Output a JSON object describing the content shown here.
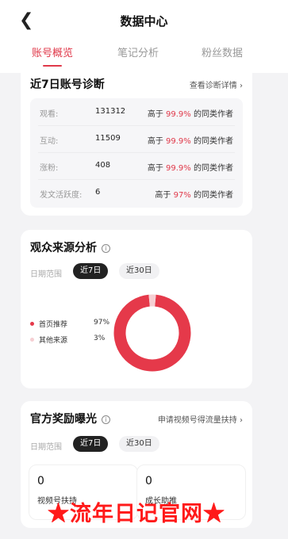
{
  "header": {
    "back_icon": "chevron-left-icon",
    "title": "数据中心",
    "tabs": [
      {
        "label": "账号概览",
        "active": true
      },
      {
        "label": "笔记分析",
        "active": false
      },
      {
        "label": "粉丝数据",
        "active": false
      }
    ]
  },
  "diagnosis": {
    "title": "近7日账号诊断",
    "link": "查看诊断详情 ›",
    "rows": [
      {
        "label": "观看:",
        "value": "131312",
        "prefix": "高于",
        "percent": "99.9%",
        "suffix": "的同类作者"
      },
      {
        "label": "互动:",
        "value": "11509",
        "prefix": "高于",
        "percent": "99.9%",
        "suffix": "的同类作者"
      },
      {
        "label": "涨粉:",
        "value": "408",
        "prefix": "高于",
        "percent": "99.9%",
        "suffix": "的同类作者"
      },
      {
        "label": "发文活跃度:",
        "value": "6",
        "prefix": "高于",
        "percent": "97%",
        "suffix": "的同类作者"
      }
    ]
  },
  "audience": {
    "title": "观众来源分析",
    "info_icon": "ⓘ",
    "range_label": "日期范围",
    "pills": [
      {
        "label": "近7日",
        "active": true
      },
      {
        "label": "近30日",
        "active": false
      }
    ],
    "legend": [
      {
        "label": "首页推荐",
        "percent": "97%",
        "color": "#e5394a"
      },
      {
        "label": "其他来源",
        "percent": "3%",
        "color": "#f6cfd3"
      }
    ]
  },
  "chart_data": {
    "type": "pie",
    "style": "donut",
    "categories": [
      "首页推荐",
      "其他来源"
    ],
    "values": [
      97,
      3
    ],
    "colors": [
      "#e5394a",
      "#f6cfd3"
    ]
  },
  "rewards": {
    "title": "官方奖励曝光",
    "info_icon": "ⓘ",
    "link": "申请视频号得流量扶持 ›",
    "range_label": "日期范围",
    "pills": [
      {
        "label": "近7日",
        "active": true
      },
      {
        "label": "近30日",
        "active": false
      }
    ],
    "cards": [
      {
        "value": "0",
        "label": "视频号扶持"
      },
      {
        "value": "0",
        "label": "成长助推"
      }
    ]
  },
  "watermark": {
    "text": "流年日记官网",
    "star": "★"
  }
}
